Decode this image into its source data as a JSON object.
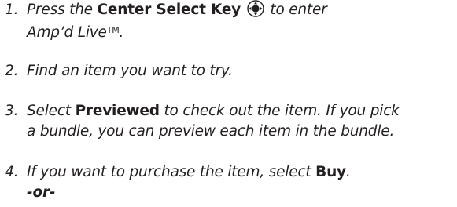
{
  "steps": [
    {
      "number": "1.",
      "text_before": "Press the ",
      "bold": "Center Select Key",
      "icon": "center-select-key-icon",
      "text_after": " to enter",
      "line2": "Amp’d Live",
      "trademark": "TM",
      "line2_end": "."
    },
    {
      "number": "2.",
      "text": "Find an item you want to try."
    },
    {
      "number": "3.",
      "text_before": "Select ",
      "bold": "Previewed",
      "text_after": " to check out the item. If you pick",
      "line2": "a bundle, you can preview each item in the bundle."
    },
    {
      "number": "4.",
      "text_before": "If you want to purchase the item, select ",
      "bold": "Buy",
      "text_after": ".",
      "line2": "-or-"
    }
  ]
}
